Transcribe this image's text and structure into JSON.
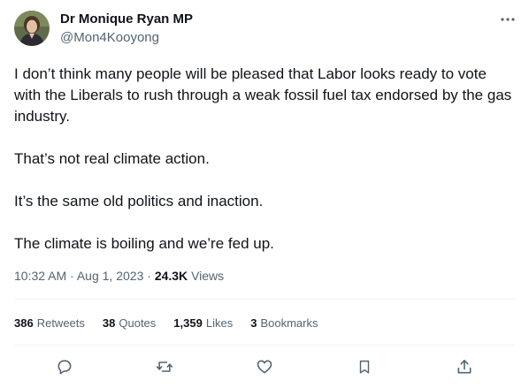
{
  "author": {
    "name": "Dr Monique Ryan MP",
    "handle": "@Mon4Kooyong"
  },
  "tweet": {
    "paragraphs": [
      "I don’t think many people will be pleased that Labor looks ready to vote with the Liberals to rush through a weak fossil fuel tax endorsed by the gas industry.",
      "That’s not real climate action.",
      "It’s the same old politics and inaction.",
      "The climate is boiling and we’re fed up."
    ],
    "time": "10:32 AM",
    "separator": "·",
    "date": "Aug 1, 2023",
    "views_count": "24.3K",
    "views_label": "Views"
  },
  "stats": {
    "retweets_count": "386",
    "retweets_label": "Retweets",
    "quotes_count": "38",
    "quotes_label": "Quotes",
    "likes_count": "1,359",
    "likes_label": "Likes",
    "bookmarks_count": "3",
    "bookmarks_label": "Bookmarks"
  },
  "icons": {
    "more": "more-horizontal-icon",
    "reply": "reply-icon",
    "retweet": "retweet-icon",
    "like": "heart-icon",
    "bookmark": "bookmark-icon",
    "share": "share-icon"
  },
  "colors": {
    "text": "#0f1419",
    "secondary": "#536471",
    "divider": "#eff3f4"
  }
}
